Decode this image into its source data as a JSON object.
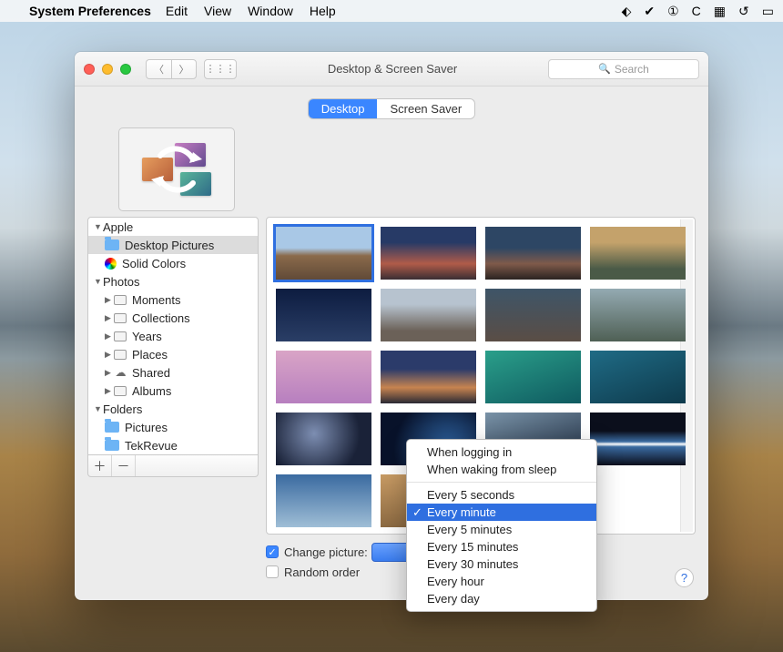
{
  "menubar": {
    "app": "System Preferences",
    "items": [
      "Edit",
      "View",
      "Window",
      "Help"
    ]
  },
  "window": {
    "title": "Desktop & Screen Saver",
    "search_placeholder": "Search"
  },
  "tabs": {
    "desktop": "Desktop",
    "screensaver": "Screen Saver"
  },
  "sidebar": {
    "apple": {
      "label": "Apple",
      "desktop_pictures": "Desktop Pictures",
      "solid_colors": "Solid Colors"
    },
    "photos": {
      "label": "Photos",
      "items": [
        "Moments",
        "Collections",
        "Years",
        "Places",
        "Shared",
        "Albums"
      ]
    },
    "folders": {
      "label": "Folders",
      "items": [
        "Pictures",
        "TekRevue"
      ]
    }
  },
  "options": {
    "change_picture": "Change picture:",
    "random_order": "Random order"
  },
  "dropdown": {
    "groups": [
      [
        "When logging in",
        "When waking from sleep"
      ],
      [
        "Every 5 seconds",
        "Every minute",
        "Every 5 minutes",
        "Every 15 minutes",
        "Every 30 minutes",
        "Every hour",
        "Every day"
      ]
    ],
    "selected": "Every minute"
  }
}
